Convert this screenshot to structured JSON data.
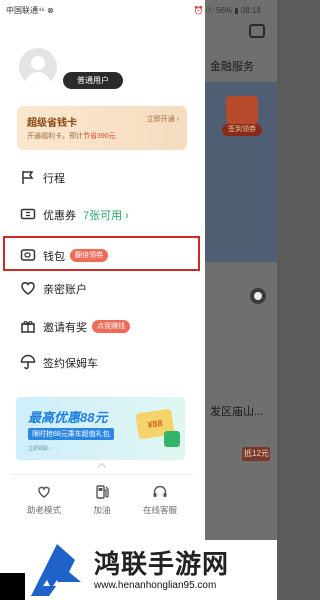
{
  "status_bar": {
    "carrier": "中国联通⁴⁶ ⊗",
    "right": "⏰ ⓝ 56% ▮ 08:18"
  },
  "background": {
    "title": "金融服务",
    "banner_pill": "签到领券",
    "text": "发区庙山...",
    "badge": "抵12元"
  },
  "profile": {
    "user_type": "普通用户"
  },
  "vip_card": {
    "title": "超级省钱卡",
    "subtitle": "开通福利卡，预计",
    "subtitle_save": "节省390元",
    "button": "立即开通 ›"
  },
  "menu": {
    "trip": {
      "label": "行程"
    },
    "coupon": {
      "label": "优惠券",
      "extra": "7张可用 ›"
    },
    "wallet": {
      "label": "钱包",
      "tag": "翻倍领券"
    },
    "family": {
      "label": "亲密账户"
    },
    "invite": {
      "label": "邀请有奖",
      "tag": "点我赚钱"
    },
    "nanny": {
      "label": "签约保姆车"
    }
  },
  "promo": {
    "title": "最高优惠88元",
    "subtitle": "限时抢88元乘车超值礼包",
    "note": "立即领取 ›",
    "coupon": "¥88"
  },
  "bottom_bar": {
    "elder_mode": "助老模式",
    "fuel": "加油",
    "customer_service": "在线客服"
  },
  "watermark": {
    "title": "鸿联手游网",
    "url": "www.henanhonglian95.com"
  },
  "colors": {
    "accent_green": "#27a862",
    "highlight_red": "#cc2b2b",
    "tag_red": "#ee6b57"
  }
}
